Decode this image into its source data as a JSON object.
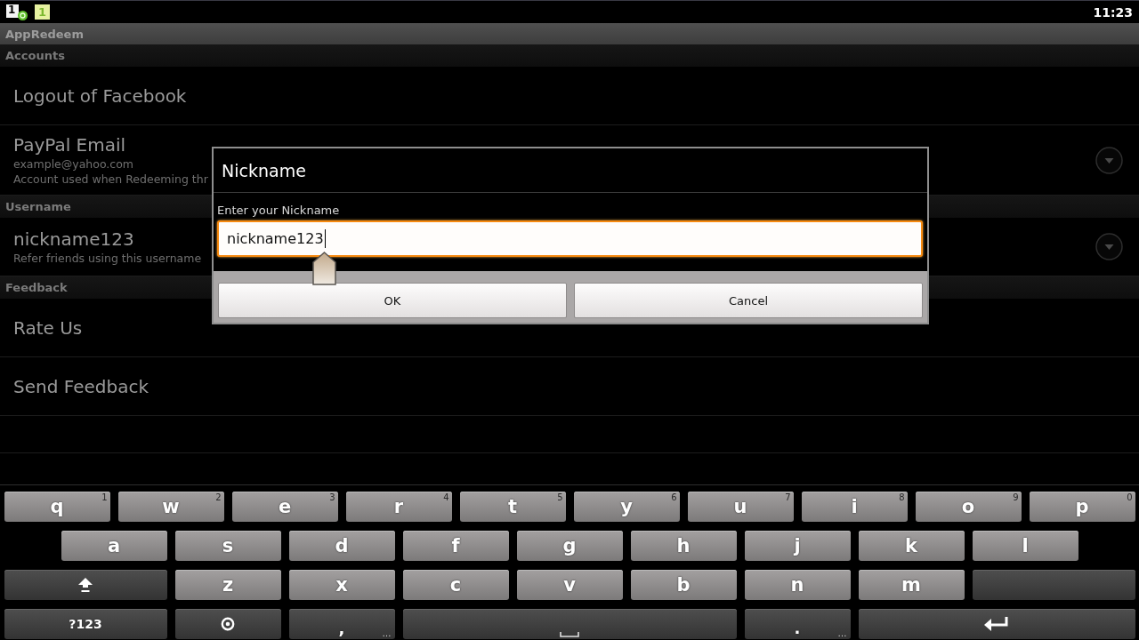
{
  "status_bar": {
    "notifications": [
      {
        "kind": "synced",
        "label": "1"
      },
      {
        "kind": "plain",
        "label": "1"
      }
    ],
    "time": "11:23"
  },
  "app_bar": {
    "title": "AppRedeem"
  },
  "preferences": [
    {
      "kind": "header",
      "title": "Accounts"
    },
    {
      "kind": "action",
      "title": "Logout of Facebook"
    },
    {
      "kind": "dropdown",
      "title": "PayPal Email",
      "summary": [
        "example@yahoo.com",
        "Account used when Redeeming thr"
      ]
    },
    {
      "kind": "header",
      "title": "Username"
    },
    {
      "kind": "dropdown",
      "title": "nickname123",
      "summary": [
        "Refer friends using this username"
      ]
    },
    {
      "kind": "header",
      "title": "Feedback"
    },
    {
      "kind": "action",
      "title": "Rate Us"
    },
    {
      "kind": "action",
      "title": "Send Feedback"
    }
  ],
  "dialog": {
    "title": "Nickname",
    "label": "Enter your Nickname",
    "input": {
      "value": "nickname123",
      "focused": true
    },
    "buttons": [
      "OK",
      "Cancel"
    ]
  },
  "keyboard": {
    "rows": [
      [
        {
          "kind": "letter",
          "label": "q",
          "hint": "1"
        },
        {
          "kind": "letter",
          "label": "w",
          "hint": "2"
        },
        {
          "kind": "letter",
          "label": "e",
          "hint": "3"
        },
        {
          "kind": "letter",
          "label": "r",
          "hint": "4"
        },
        {
          "kind": "letter",
          "label": "t",
          "hint": "5"
        },
        {
          "kind": "letter",
          "label": "y",
          "hint": "6"
        },
        {
          "kind": "letter",
          "label": "u",
          "hint": "7"
        },
        {
          "kind": "letter",
          "label": "i",
          "hint": "8"
        },
        {
          "kind": "letter",
          "label": "o",
          "hint": "9"
        },
        {
          "kind": "letter",
          "label": "p",
          "hint": "0"
        }
      ],
      [
        {
          "kind": "letter",
          "label": "a"
        },
        {
          "kind": "letter",
          "label": "s"
        },
        {
          "kind": "letter",
          "label": "d"
        },
        {
          "kind": "letter",
          "label": "f"
        },
        {
          "kind": "letter",
          "label": "g"
        },
        {
          "kind": "letter",
          "label": "h"
        },
        {
          "kind": "letter",
          "label": "j"
        },
        {
          "kind": "letter",
          "label": "k"
        },
        {
          "kind": "letter",
          "label": "l"
        }
      ],
      [
        {
          "kind": "shift"
        },
        {
          "kind": "letter",
          "label": "z"
        },
        {
          "kind": "letter",
          "label": "x"
        },
        {
          "kind": "letter",
          "label": "c"
        },
        {
          "kind": "letter",
          "label": "v"
        },
        {
          "kind": "letter",
          "label": "b"
        },
        {
          "kind": "letter",
          "label": "n"
        },
        {
          "kind": "letter",
          "label": "m"
        },
        {
          "kind": "blank"
        }
      ],
      [
        {
          "kind": "symbols",
          "label": "?123"
        },
        {
          "kind": "settings"
        },
        {
          "kind": "comma",
          "label": ",",
          "hint": "…"
        },
        {
          "kind": "space"
        },
        {
          "kind": "period",
          "label": ".",
          "hint": "…"
        },
        {
          "kind": "enter"
        }
      ]
    ]
  }
}
